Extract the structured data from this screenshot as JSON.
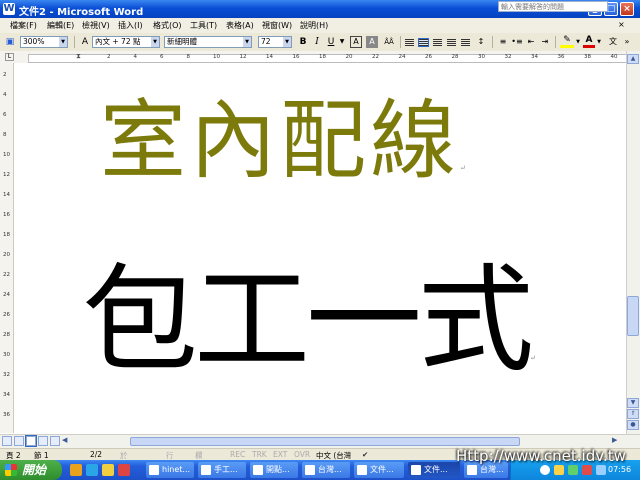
{
  "window": {
    "title": "文件2 - Microsoft Word",
    "minimize_glyph": "_",
    "maximize_glyph": "□",
    "close_glyph": "×"
  },
  "menu": {
    "items": [
      "檔案(F)",
      "編輯(E)",
      "檢視(V)",
      "插入(I)",
      "格式(O)",
      "工具(T)",
      "表格(A)",
      "視窗(W)",
      "說明(H)"
    ],
    "help_placeholder": "輸入需要解答的問題"
  },
  "toolbar": {
    "zoom": "300%",
    "style": "內文 + 72 點",
    "font": "新細明體",
    "size": "72",
    "bold": "B",
    "italic": "I",
    "underline": "U",
    "font_color_label": "A"
  },
  "ruler": {
    "top_numbers": [
      "2",
      "4",
      "6",
      "8",
      "10",
      "12",
      "14",
      "16",
      "18",
      "20",
      "22",
      "24",
      "26",
      "28",
      "30",
      "32",
      "34",
      "36",
      "38",
      "40",
      "42"
    ],
    "left_numbers": [
      "2",
      "4",
      "6",
      "8",
      "10",
      "12",
      "14",
      "16",
      "18",
      "20",
      "22",
      "24",
      "26",
      "28",
      "30",
      "32",
      "34",
      "36"
    ]
  },
  "document": {
    "line1": "室內配線",
    "line2": "包工一式",
    "para_mark": "↵"
  },
  "status": {
    "page": "頁 2",
    "section": "節 1",
    "pages": "2/2",
    "at": "於",
    "line": "行",
    "col": "欄",
    "rec": "REC",
    "trk": "TRK",
    "ext": "EXT",
    "ovr": "OVR",
    "language": "中文 (台灣"
  },
  "taskbar": {
    "start": "開始",
    "buttons": [
      "hinet...",
      "手工...",
      "開點...",
      "台灣...",
      "文件...",
      "文件...",
      "台灣..."
    ],
    "clock": "07:56",
    "watermark": "Http://www.cnet.idv.tw"
  },
  "colors": {
    "title_text": "#7d7a0c",
    "body_text": "#000000",
    "titlebar": "#0a4fd6",
    "taskbar": "#245edb",
    "start_button": "#2f8d2c"
  }
}
